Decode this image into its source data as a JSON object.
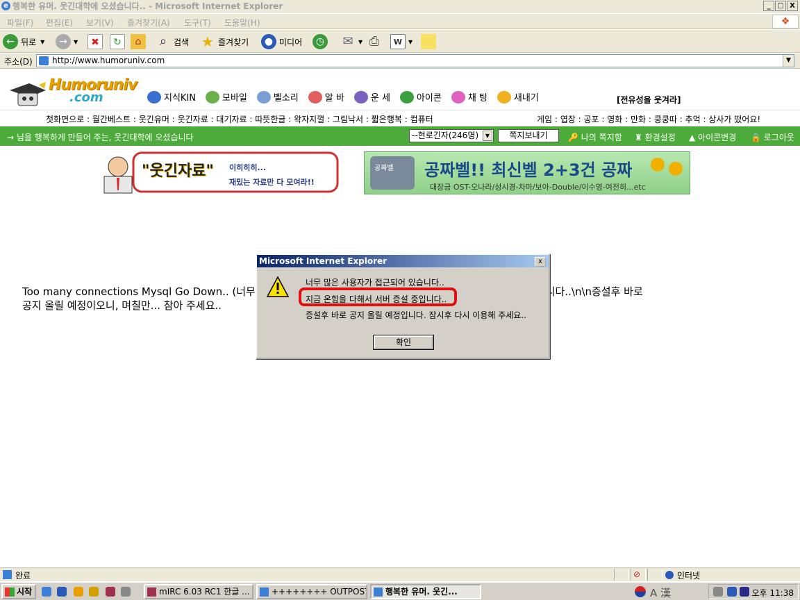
{
  "window": {
    "title": "행복한 유머. 웃긴대학에 오셨습니다.. - Microsoft Internet Explorer",
    "min_label": "_",
    "max_label": "□",
    "close_label": "X"
  },
  "menubar": [
    "파일(F)",
    "편집(E)",
    "보기(V)",
    "즐겨찾기(A)",
    "도구(T)",
    "도움말(H)"
  ],
  "toolbar": {
    "back": "뒤로",
    "search": "검색",
    "favorites": "즐겨찾기",
    "media": "미디어"
  },
  "address": {
    "label": "주소(D)",
    "url": "http://www.humoruniv.com"
  },
  "site": {
    "logo_word": "Humoruniv",
    "logo_dotcom": ".com",
    "categories": [
      "지식KIN",
      "모바일",
      "벨소리",
      "알 바",
      "운 세",
      "아이콘",
      "채 팅",
      "새내기"
    ],
    "category_colors": [
      "#3a6fd0",
      "#6ab04c",
      "#7a9fd8",
      "#e06060",
      "#7a60c0",
      "#3aa040",
      "#e060c0",
      "#f0b020"
    ],
    "slogan": "[전유성을 웃겨라]",
    "subnav_left": "첫화면으로 : 월간베스트 : 웃긴유머 : 웃긴자료 : 대기자료 : 따뜻한글 : 왁자지껄 : 그림낙서 : 짧은행복 : 컴퓨터",
    "subnav_right": "게임 : 엽장 : 공포 : 영화 : 만화 : 쿵쿵따 : 추억 : 상사가 떴어요!",
    "welcome": "→ 님을 행복하게 만들어 주는, 웃긴대학에 오셨습니다",
    "online_select": "--현로긴자(246명)",
    "send_message": "쪽지보내기",
    "links": [
      "나의 쪽지함",
      "환경설정",
      "아이콘변경",
      "로그아웃"
    ],
    "banner1_title": "\"웃긴자료\"",
    "banner1_sub1": "이히히히...",
    "banner1_sub2": "재밌는 자료만 다 모여라!!",
    "banner2_tag": "공짜벨",
    "banner2_headline": "공짜벨!! 최신벨 2+3건 공짜",
    "banner2_sub": "대장금 OST-오나라/성시경-차마/보아-Double/이수영-여전히...etc",
    "body_line1_a": "Too many connections Mysql Go Down.. (너무",
    "body_line1_b": "서 서버 증설 중입니다..\\n\\n증설후 바로",
    "body_line2": "공지 올릴 예정이오니, 며칠만... 참아 주세요.. "
  },
  "dialog": {
    "title": "Microsoft Internet Explorer",
    "close": "x",
    "line1": "너무 많은 사용자가 접근되어 있습니다..",
    "line2": "지금 온힘을 다해서 서버 증설 중입니다..",
    "line3": "증설후 바로 공지 올릴 예정입니다. 잠시후 다시 이용해 주세요..",
    "ok": "확인",
    "highlight_color": "#e01010"
  },
  "statusbar": {
    "text": "완료",
    "zone": "인터넷"
  },
  "taskbar": {
    "start": "시작",
    "tasks": [
      "mIRC 6.03 RC1 한글 ...",
      "++++++++ OUTPOST +...",
      "행복한 유머. 웃긴..."
    ],
    "clock": "오후 11:38",
    "ime": "A 漢"
  }
}
